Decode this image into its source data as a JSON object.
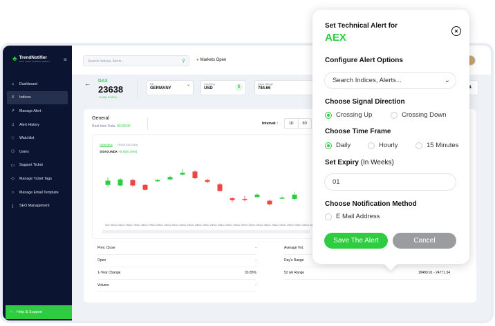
{
  "brand": {
    "name": "TrendNotifier",
    "tagline": "Stock market notification platform"
  },
  "sidebar": {
    "items": [
      {
        "label": "Dashboard",
        "icon": "home-icon",
        "glyph": "⌂"
      },
      {
        "label": "Indices",
        "icon": "list-icon",
        "glyph": "≡",
        "active": true
      },
      {
        "label": "Manage Alert",
        "icon": "chart-icon",
        "glyph": "↗"
      },
      {
        "label": "Alert History",
        "icon": "bell-icon",
        "glyph": "♫"
      },
      {
        "label": "Watchlist",
        "icon": "heart-icon",
        "glyph": "♡"
      },
      {
        "label": "Users",
        "icon": "user-icon",
        "glyph": "⚇"
      },
      {
        "label": "Support Ticket",
        "icon": "ticket-icon",
        "glyph": "▭"
      },
      {
        "label": "Manage Ticket Tags",
        "icon": "tag-icon",
        "glyph": "◇"
      },
      {
        "label": "Manage Email Template",
        "icon": "mail-icon",
        "glyph": "○"
      },
      {
        "label": "SEO Management",
        "icon": "seo-icon",
        "glyph": "⌊"
      }
    ],
    "help": "Help & Support"
  },
  "topbar": {
    "search_placeholder": "Search Indices, Alerts...",
    "market_status": "Markets Open"
  },
  "stock": {
    "ticker": "DAX",
    "price": "23638",
    "change": "+4.45(+0.48%) ↑",
    "country_label": "DE",
    "country_value": "GERMANY",
    "currency_label": "Currency",
    "currency_value": "USD",
    "days_range_label": "Days Range",
    "days_range_value": "784.66",
    "partial_right": "34"
  },
  "general": {
    "title": "General",
    "realtime_label": "Real-time Data:",
    "realtime_time": "03:00:00",
    "interval_label": "Interval :",
    "interval_options": [
      "1D",
      "5D"
    ],
    "tabs": [
      "Overview",
      "Historical Data"
    ],
    "symbol": "@DAX.INDX",
    "symbol_change": "+5.55(0.48%)"
  },
  "chart_data": {
    "type": "candlestick",
    "categories": [
      "Nov 25",
      "Nov 25",
      "Nov 25",
      "Nov 25",
      "Nov 25",
      "Nov 25",
      "Nov 25",
      "Nov 25",
      "Nov 25",
      "Nov 25",
      "Nov 25",
      "Nov 25",
      "Nov 25",
      "Nov 25",
      "Nov 25",
      "Nov 25",
      "Nov 25",
      "Nov 25",
      "Nov 25",
      "Nov 25",
      "Nov 25",
      "Nov 25",
      "Nov 25",
      "Nov 25",
      "Nov 25",
      "Nov 25",
      "Nov 25"
    ],
    "candles": [
      {
        "open": 0.56,
        "close": 0.63,
        "high": 0.68,
        "low": 0.53
      },
      {
        "open": 0.55,
        "close": 0.65,
        "high": 0.67,
        "low": 0.54
      },
      {
        "open": 0.64,
        "close": 0.55,
        "high": 0.66,
        "low": 0.53
      },
      {
        "open": 0.56,
        "close": 0.48,
        "high": 0.57,
        "low": 0.47
      },
      {
        "open": 0.62,
        "close": 0.64,
        "high": 0.66,
        "low": 0.61
      },
      {
        "open": 0.65,
        "close": 0.69,
        "high": 0.71,
        "low": 0.64
      },
      {
        "open": 0.73,
        "close": 0.76,
        "high": 0.82,
        "low": 0.72
      },
      {
        "open": 0.78,
        "close": 0.67,
        "high": 0.8,
        "low": 0.66
      },
      {
        "open": 0.64,
        "close": 0.61,
        "high": 0.66,
        "low": 0.59
      },
      {
        "open": 0.57,
        "close": 0.46,
        "high": 0.59,
        "low": 0.45
      },
      {
        "open": 0.34,
        "close": 0.31,
        "high": 0.36,
        "low": 0.28
      },
      {
        "open": 0.33,
        "close": 0.32,
        "high": 0.38,
        "low": 0.29
      },
      {
        "open": 0.36,
        "close": 0.4,
        "high": 0.42,
        "low": 0.35
      },
      {
        "open": 0.3,
        "close": 0.24,
        "high": 0.32,
        "low": 0.22
      },
      {
        "open": 0.34,
        "close": 0.35,
        "high": 0.37,
        "low": 0.33
      },
      {
        "open": 0.33,
        "close": 0.4,
        "high": 0.44,
        "low": 0.31
      }
    ],
    "up_color": "#2ecc40",
    "down_color": "#ee4444"
  },
  "stats": [
    {
      "label": "Prev. Close",
      "value": "-"
    },
    {
      "label": "Open",
      "value": "-"
    },
    {
      "label": "1-Year Change",
      "value": "33.85%"
    },
    {
      "label": "Volume",
      "value": "-"
    },
    {
      "label": "Average Vol.",
      "value": ""
    },
    {
      "label": "Day's Range",
      "value": ""
    },
    {
      "label": "52 wk Range",
      "value": "18489.91 - 24771.34"
    }
  ],
  "alert_popup": {
    "title": "Set Technical Alert for",
    "symbol": "AEX",
    "configure_heading": "Configure Alert Options",
    "search_placeholder": "Search Indices, Alerts...",
    "direction_heading": "Choose Signal Direction",
    "direction_options": [
      "Crossing Up",
      "Crossing Down"
    ],
    "direction_selected": "Crossing Up",
    "timeframe_heading": "Choose Time Frame",
    "timeframe_options": [
      "Daily",
      "Hourly",
      "15 Minutes"
    ],
    "timeframe_selected": "Daily",
    "expiry_heading": "Set Expiry",
    "expiry_unit": "(In Weeks)",
    "expiry_value": "01",
    "notification_heading": "Choose Notification Method",
    "notification_option": "E Mail Address",
    "save_label": "Save The Alert",
    "cancel_label": "Cancel",
    "accent": "#2ecc40"
  }
}
